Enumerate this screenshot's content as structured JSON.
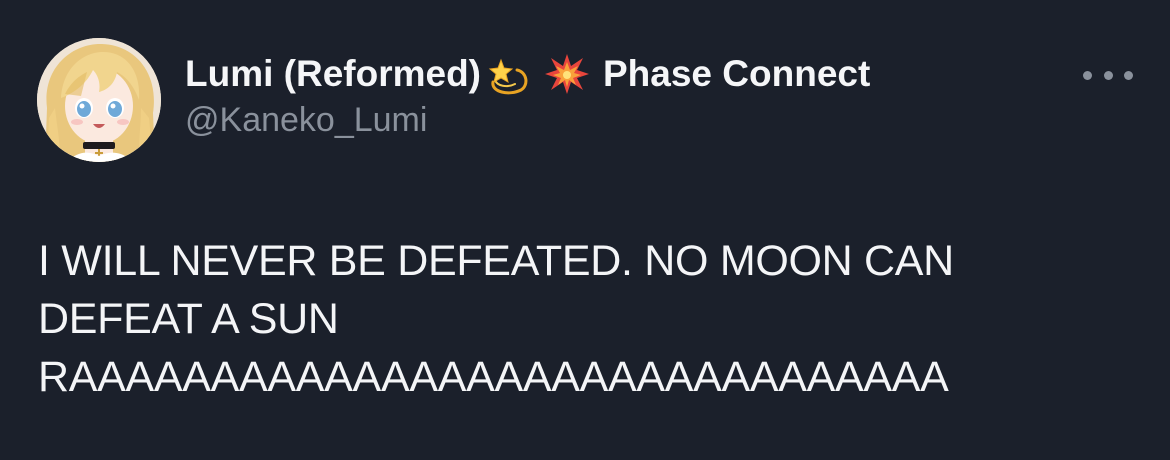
{
  "author": {
    "display_name": "Lumi (Reformed)",
    "affiliation": "Phase Connect",
    "handle": "@Kaneko_Lumi",
    "name_emojis": [
      "dizzy-star-icon",
      "collision-icon"
    ]
  },
  "tweet": {
    "lines": [
      "I WILL NEVER BE DEFEATED. NO MOON CAN",
      "DEFEAT A SUN",
      "RAAAAAAAAAAAAAAAAAAAAAAAAAAAAAAA"
    ]
  },
  "colors": {
    "background": "#1b202b",
    "primary_text": "#f4f5f7",
    "secondary_text": "#8a919c"
  },
  "icons": {
    "more": "more-options-icon"
  }
}
